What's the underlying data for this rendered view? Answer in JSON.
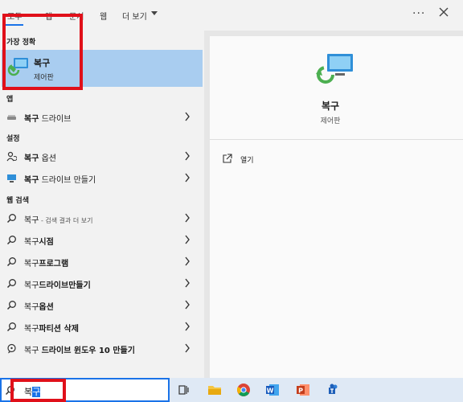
{
  "tabs": [
    {
      "label": "모두"
    },
    {
      "label": "앱"
    },
    {
      "label": "문서"
    },
    {
      "label": "웹"
    },
    {
      "label": "더 보기"
    }
  ],
  "more_icon": "ellipsis-icon",
  "close_icon": "close-icon",
  "best_match": {
    "section": "가장 정확",
    "title": "복구",
    "subtitle": "제어판",
    "icon": "recovery-icon"
  },
  "apps": {
    "section": "앱",
    "items": [
      {
        "bold": "복구",
        "rest": " 드라이브",
        "icon": "drive-icon"
      }
    ]
  },
  "settings": {
    "section": "설정",
    "items": [
      {
        "bold": "복구",
        "rest": " 옵션",
        "icon": "person-sync-icon"
      },
      {
        "bold": "복구",
        "rest": " 드라이브 만들기",
        "icon": "monitor-icon"
      }
    ]
  },
  "web": {
    "section": "웹 검색",
    "items": [
      {
        "plain": "복구",
        "muted": " - 검색 결과 더 보기",
        "bold": "",
        "icon": "search-icon"
      },
      {
        "plain": "복구",
        "muted": "",
        "bold": "시점",
        "icon": "search-icon"
      },
      {
        "plain": "복구",
        "muted": "",
        "bold": "프로그램",
        "icon": "search-icon"
      },
      {
        "plain": "복구",
        "muted": "",
        "bold": "드라이브만들기",
        "icon": "search-icon"
      },
      {
        "plain": "복구",
        "muted": "",
        "bold": "옵션",
        "icon": "search-icon"
      },
      {
        "plain": "복구",
        "muted": "",
        "bold": "파티션 삭제",
        "icon": "search-icon"
      },
      {
        "plain": "복구 ",
        "muted": "",
        "bold": "드라이브 윈도우 10 만들기",
        "icon": "chat-icon"
      }
    ]
  },
  "detail": {
    "title": "복구",
    "subtitle": "제어판",
    "action_label": "열기",
    "icon": "recovery-icon"
  },
  "search": {
    "typed_prefix": "복",
    "typed_selected": "구"
  },
  "taskbar_icons": [
    "task-view-icon",
    "file-explorer-icon",
    "chrome-icon",
    "word-icon",
    "powerpoint-icon",
    "teams-icon"
  ],
  "colors": {
    "accent": "#1a73e8",
    "highlight": "#a9cdf0",
    "annotation": "#e0101a"
  }
}
